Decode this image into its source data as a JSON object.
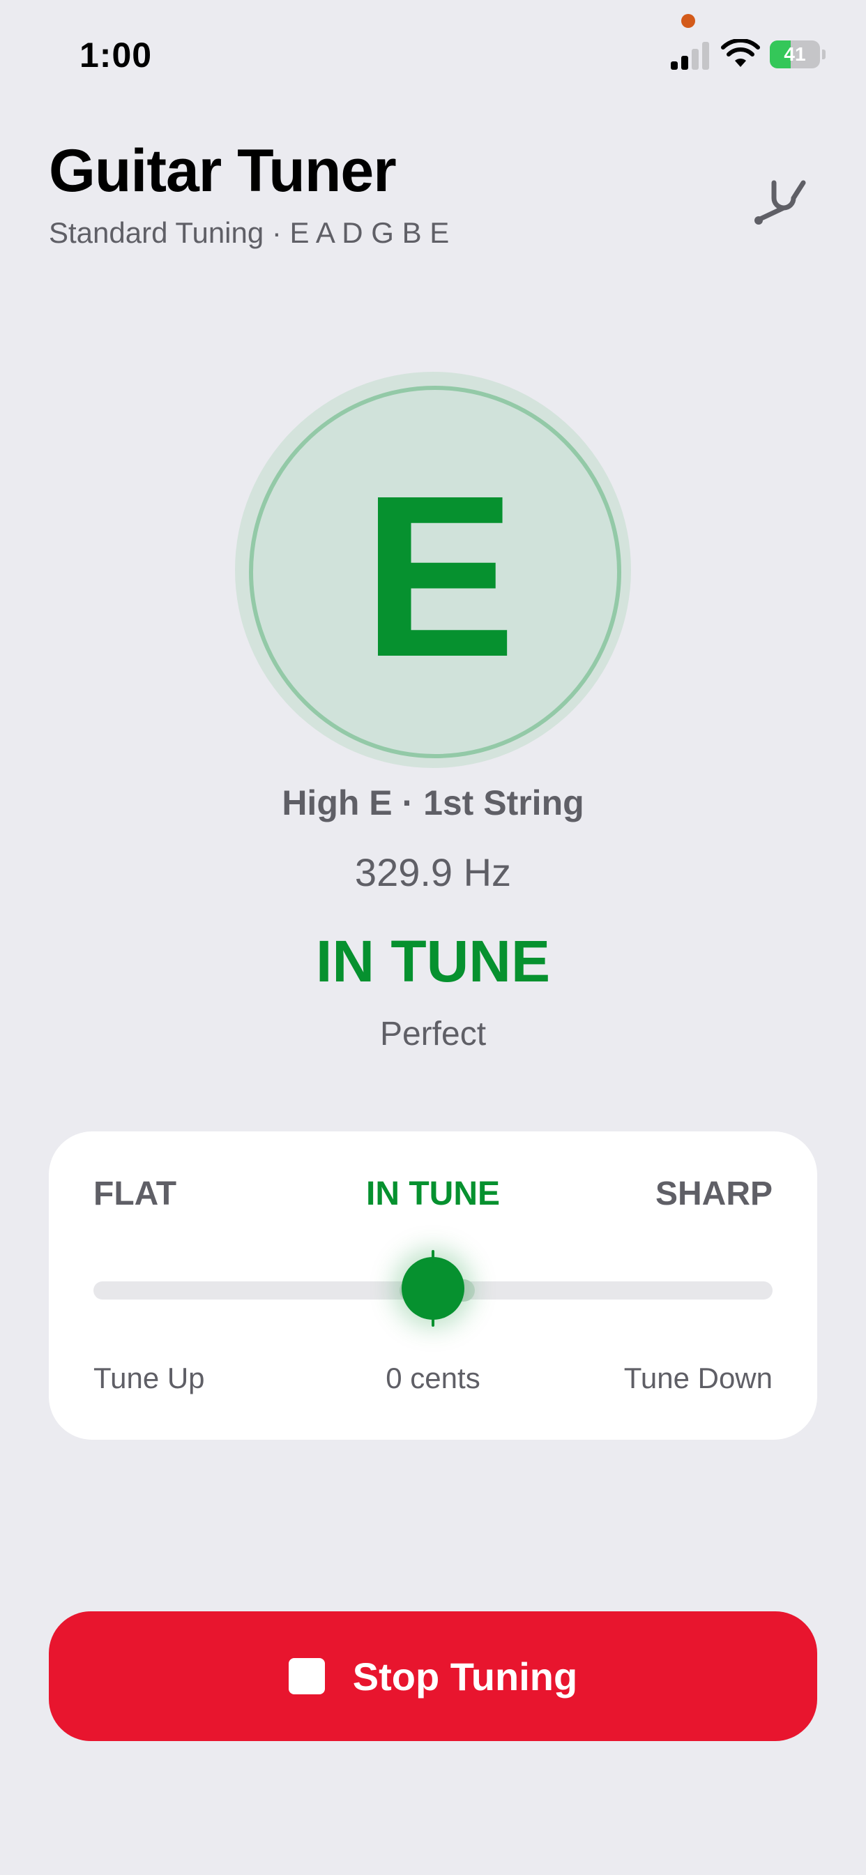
{
  "status_bar": {
    "time": "1:00",
    "battery": {
      "percent": 41,
      "label": "41",
      "charging": true
    },
    "icons": [
      "cellular-signal-icon",
      "wifi-icon",
      "battery-icon",
      "microphone-indicator"
    ]
  },
  "header": {
    "title": "Guitar Tuner",
    "subtitle": "Standard Tuning · E A D G B E",
    "tuning_fork_icon": "tuning-fork-icon"
  },
  "note": {
    "letter": "E",
    "string_name": "High E · 1st String",
    "frequency": "329.9 Hz",
    "status": "IN TUNE",
    "status_detail": "Perfect"
  },
  "meter": {
    "flat_label": "FLAT",
    "in_tune_label": "IN TUNE",
    "sharp_label": "SHARP",
    "tune_up_label": "Tune Up",
    "cents_label": "0 cents",
    "tune_down_label": "Tune Down",
    "cents_value": 0
  },
  "stop_button": {
    "label": "Stop Tuning",
    "icon": "stop-icon"
  },
  "colors": {
    "accent_green": "#06912f",
    "stop_red": "#e8152e",
    "background": "#ebebf0",
    "secondary_text": "#5f5f66"
  }
}
